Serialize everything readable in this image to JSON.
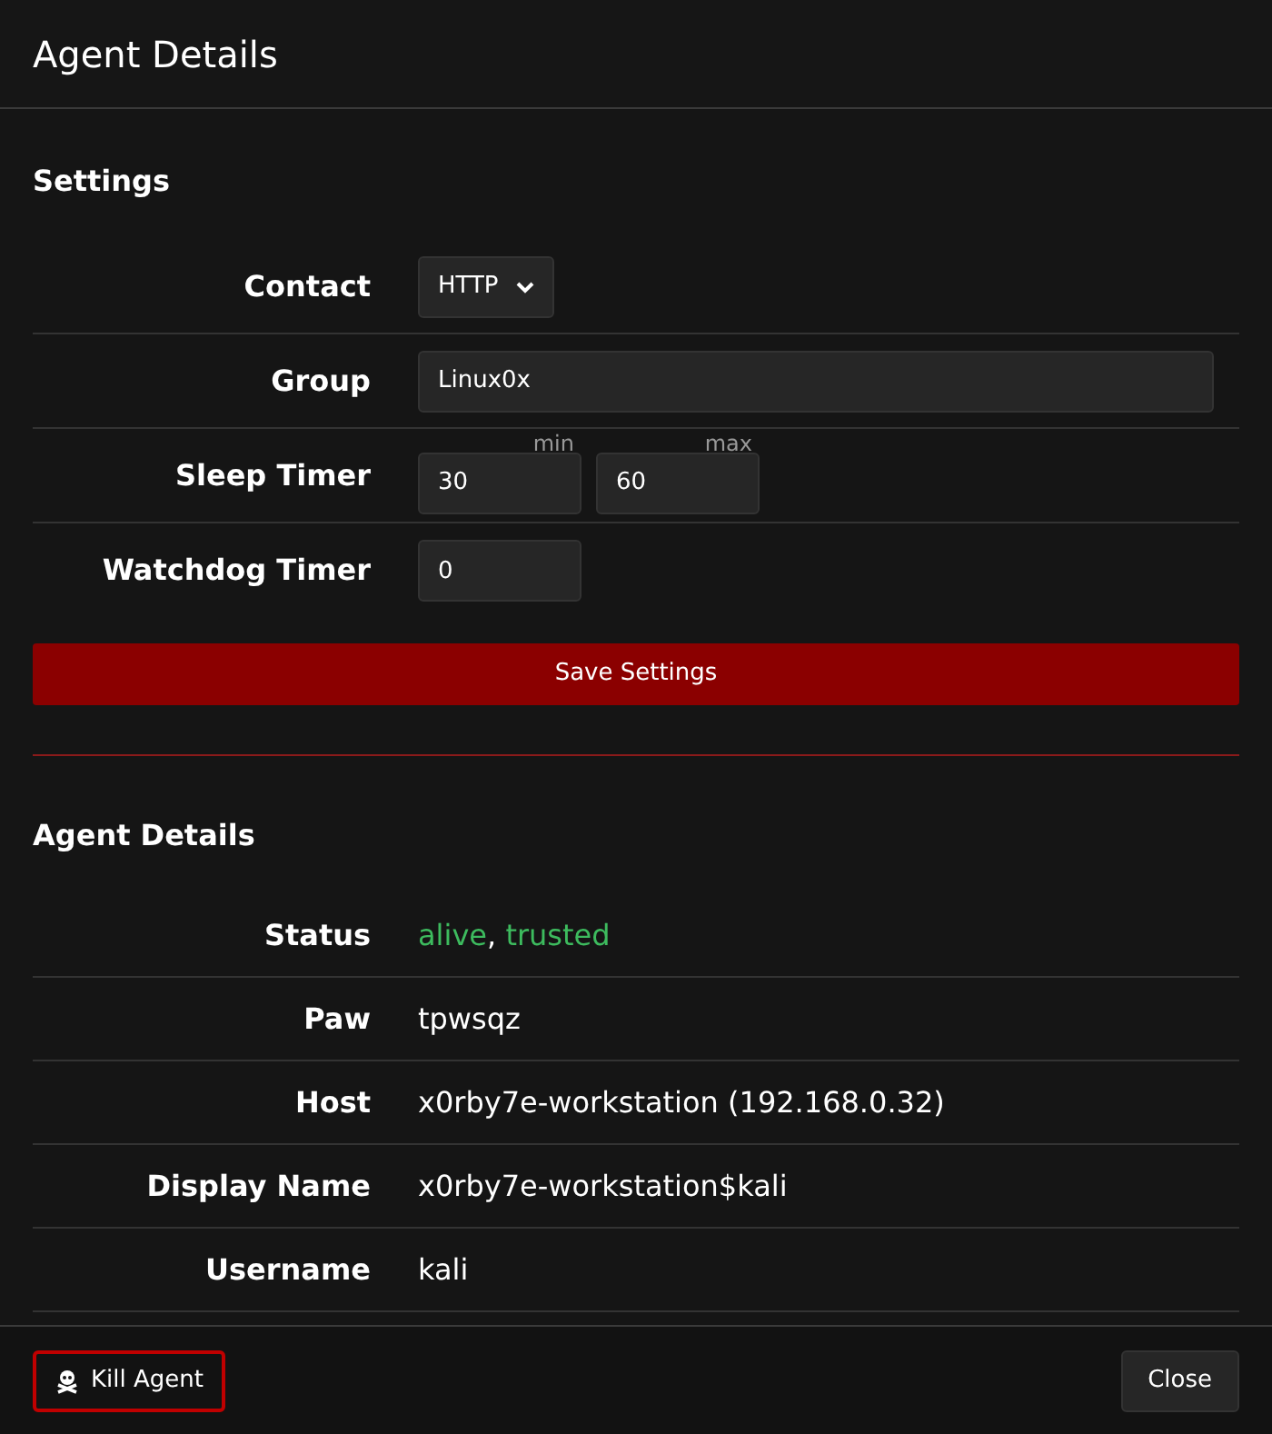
{
  "window": {
    "title": "Agent Details"
  },
  "settings": {
    "heading": "Settings",
    "rows": [
      {
        "kind": "select",
        "label": "Contact",
        "value": "HTTP"
      },
      {
        "kind": "text",
        "label": "Group",
        "value": "Linux0x"
      },
      {
        "kind": "range",
        "label": "Sleep Timer",
        "min": {
          "caption": "min",
          "value": "30"
        },
        "max": {
          "caption": "max",
          "value": "60"
        }
      },
      {
        "kind": "number",
        "label": "Watchdog Timer",
        "value": "0"
      }
    ],
    "save_button": "Save Settings"
  },
  "details": {
    "heading": "Agent Details",
    "status": {
      "label": "Status",
      "separator": ", ",
      "tags": [
        {
          "text": "alive",
          "color": "#3dbb5e"
        },
        {
          "text": "trusted",
          "color": "#3dbb5e"
        }
      ]
    },
    "rows": [
      {
        "label": "Paw",
        "value": "tpwsqz"
      },
      {
        "label": "Host",
        "value": "x0rby7e-workstation (192.168.0.32)"
      },
      {
        "label": "Display Name",
        "value": "x0rby7e-workstation$kali"
      },
      {
        "label": "Username",
        "value": "kali"
      }
    ]
  },
  "footer": {
    "kill_button": "Kill Agent",
    "close_button": "Close"
  }
}
